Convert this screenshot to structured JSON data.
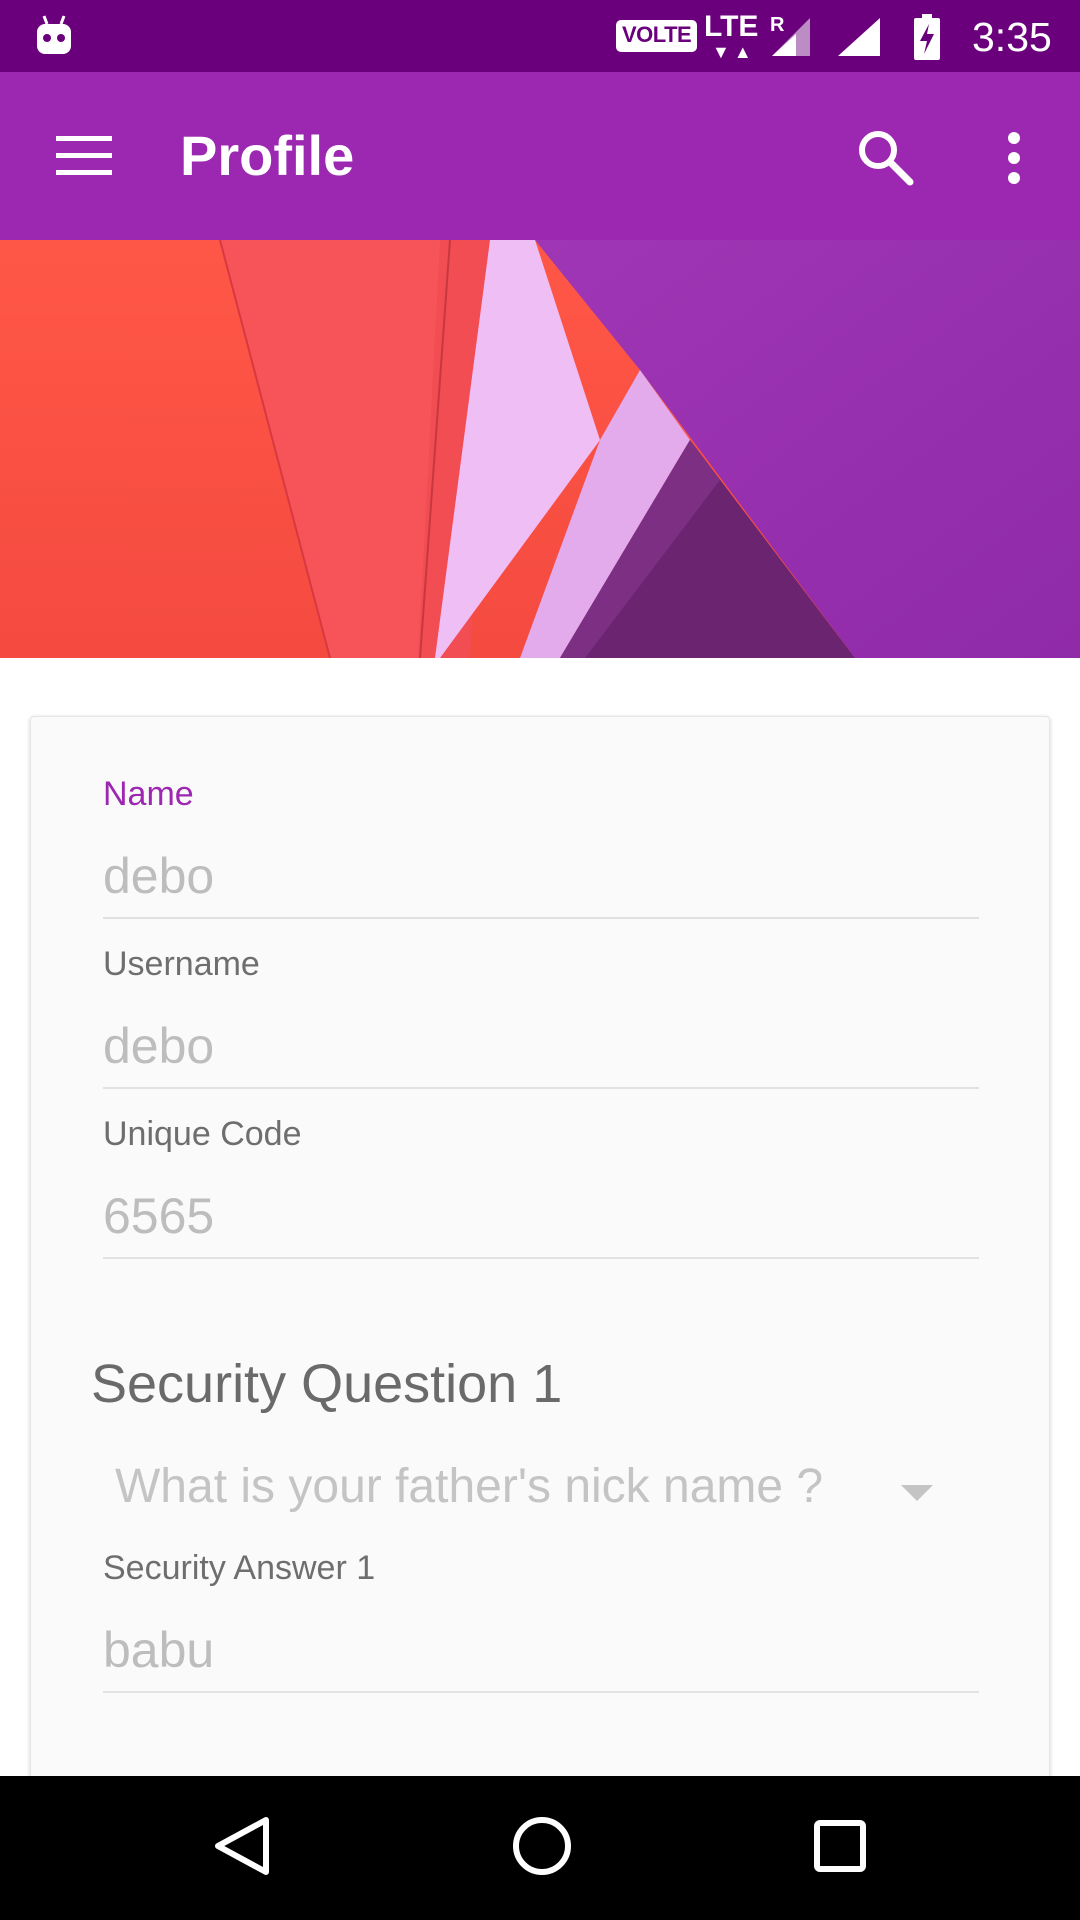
{
  "status_bar": {
    "app_icon": "android-robot-icon",
    "network_badge": "VOLTE",
    "network_type": "LTE",
    "roaming_indicator": "R",
    "data_arrows": "▼▲",
    "signal_icons": [
      "signal-strength-icon",
      "signal-strength-icon"
    ],
    "battery_icon": "battery-charging-icon",
    "time": "3:35"
  },
  "app_bar": {
    "title": "Profile",
    "menu_icon": "hamburger-menu-icon",
    "search_icon": "search-icon",
    "more_icon": "more-vertical-icon",
    "color": "#9c27b0"
  },
  "header_image": {
    "description_icon": "material-paper-background-image"
  },
  "form": {
    "name": {
      "label": "Name",
      "value": "debo"
    },
    "username": {
      "label": "Username",
      "value": "debo"
    },
    "unique_code": {
      "label": "Unique Code",
      "value": "6565"
    },
    "security_section_title": "Security Question 1",
    "security_question": {
      "selected": "What is your father's nick name ?"
    },
    "security_answer": {
      "label": "Security Answer 1",
      "value": "babu"
    }
  },
  "nav_bar": {
    "back_icon": "back-triangle-icon",
    "home_icon": "home-circle-icon",
    "recents_icon": "recents-square-icon"
  },
  "colors": {
    "status_bar": "#6a007c",
    "accent": "#9c27b0",
    "hint_text": "#bdbdbd",
    "label_text": "#6e6e6e"
  }
}
